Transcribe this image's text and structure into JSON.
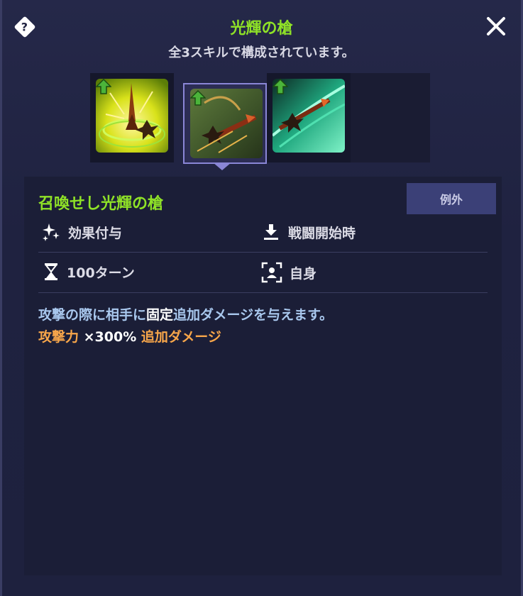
{
  "header": {
    "title": "光輝の槍",
    "subtitle": "全3スキルで構成されています。"
  },
  "icons": {
    "help": "help-diamond-icon",
    "close": "close-x-icon"
  },
  "skills": [
    {
      "name": "skill-1",
      "selected": false,
      "upgraded": true
    },
    {
      "name": "skill-2",
      "selected": true,
      "upgraded": true
    },
    {
      "name": "skill-3",
      "selected": false,
      "upgraded": true
    },
    {
      "name": "skill-empty",
      "selected": false,
      "upgraded": false
    }
  ],
  "detail": {
    "badge": "例外",
    "skill_name": "召喚せし光輝の槍",
    "type_label": "効果付与",
    "timing_label": "戦闘開始時",
    "duration_label": "100ターン",
    "target_label": "自身",
    "desc1": {
      "part1": "攻撃の際に相手に",
      "part2": "固定",
      "part3": "追加ダメージを与えます。"
    },
    "desc2": {
      "part1": "攻撃力",
      "part2": " ×300% ",
      "part3": "追加ダメージ"
    }
  },
  "colors": {
    "title_green": "#8fe227",
    "accent_purple": "#8a86d6",
    "orange": "#f7a64a",
    "blue_text": "#a9c8ee"
  }
}
